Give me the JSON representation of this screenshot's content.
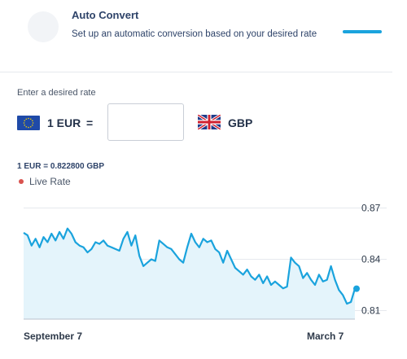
{
  "auto_convert": {
    "title": "Auto Convert",
    "description": "Set up an automatic conversion based on your desired rate"
  },
  "desired_rate": {
    "label": "Enter a desired rate",
    "from_amount_currency": "1 EUR",
    "equals": "=",
    "input_value": "",
    "to_currency": "GBP"
  },
  "rate_info": {
    "text": "1 EUR = 0.822800 GBP",
    "live_label": "Live Rate"
  },
  "colors": {
    "accent": "#1aa3dd",
    "area_fill": "#e4f4fb",
    "live_dot": "#d9534f"
  },
  "chart_data": {
    "type": "area",
    "title": "",
    "xlabel": "",
    "ylabel": "",
    "x_tick_labels": [
      "September 7",
      "March 7"
    ],
    "y_ticks": [
      0.87,
      0.84,
      0.81
    ],
    "y_tick_labels": [
      "0.87",
      "0.84",
      "0.81"
    ],
    "ylim": [
      0.805,
      0.875
    ],
    "grid": true,
    "series": [
      {
        "values": [
          0.8555,
          0.854,
          0.848,
          0.852,
          0.847,
          0.853,
          0.85,
          0.855,
          0.851,
          0.856,
          0.852,
          0.858,
          0.855,
          0.85,
          0.848,
          0.847,
          0.844,
          0.846,
          0.85,
          0.849,
          0.851,
          0.848,
          0.847,
          0.846,
          0.845,
          0.852,
          0.856,
          0.848,
          0.854,
          0.842,
          0.836,
          0.838,
          0.84,
          0.839,
          0.851,
          0.849,
          0.847,
          0.846,
          0.843,
          0.84,
          0.838,
          0.847,
          0.855,
          0.85,
          0.847,
          0.852,
          0.85,
          0.851,
          0.846,
          0.844,
          0.838,
          0.845,
          0.84,
          0.835,
          0.833,
          0.831,
          0.834,
          0.83,
          0.828,
          0.831,
          0.826,
          0.83,
          0.825,
          0.827,
          0.825,
          0.823,
          0.824,
          0.841,
          0.838,
          0.836,
          0.829,
          0.832,
          0.828,
          0.825,
          0.831,
          0.827,
          0.828,
          0.836,
          0.828,
          0.822,
          0.819,
          0.814,
          0.815,
          0.8228
        ]
      }
    ]
  }
}
